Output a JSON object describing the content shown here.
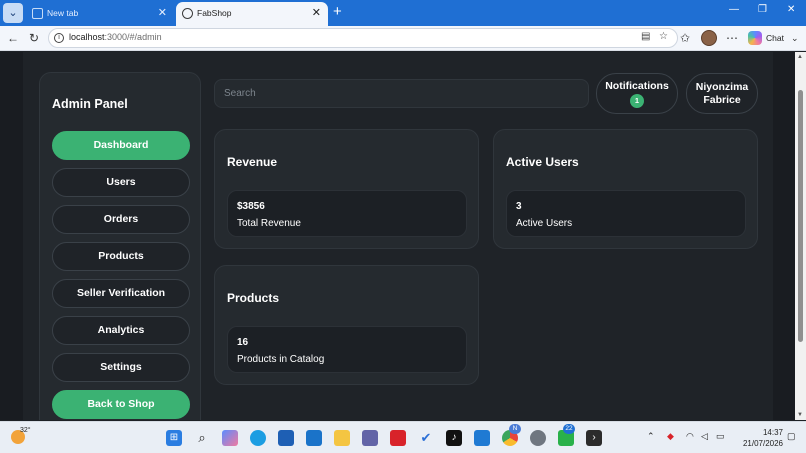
{
  "browser": {
    "tabs": [
      {
        "title": "New tab",
        "active": false
      },
      {
        "title": "FabShop",
        "active": true
      }
    ],
    "address": {
      "host": "localhost",
      "path": ":3000/#/admin"
    },
    "chat_label": "Chat"
  },
  "sidebar": {
    "title": "Admin Panel",
    "items": [
      {
        "label": "Dashboard",
        "active": true
      },
      {
        "label": "Users"
      },
      {
        "label": "Orders"
      },
      {
        "label": "Products"
      },
      {
        "label": "Seller Verification"
      },
      {
        "label": "Analytics"
      },
      {
        "label": "Settings"
      }
    ],
    "back_label": "Back to Shop"
  },
  "header": {
    "search_placeholder": "Search",
    "notifications_label": "Notifications",
    "notifications_count": "1",
    "user_name": "Niyonzima Fabrice"
  },
  "cards": {
    "revenue": {
      "title": "Revenue",
      "value": "$3856",
      "label": "Total Revenue"
    },
    "users": {
      "title": "Active Users",
      "value": "3",
      "label": "Active Users"
    },
    "products": {
      "title": "Products",
      "value": "16",
      "label": "Products in Catalog"
    }
  },
  "taskbar": {
    "temperature": "32°",
    "chrome_badge": "N",
    "whatsapp_badge": "22",
    "time": "14:37",
    "date": "21/07/2026"
  },
  "colors": {
    "accent_green": "#3bb273",
    "panel_bg": "#1f2328",
    "card_bg": "#252a2f",
    "browser_blue": "#1f6fd3"
  }
}
